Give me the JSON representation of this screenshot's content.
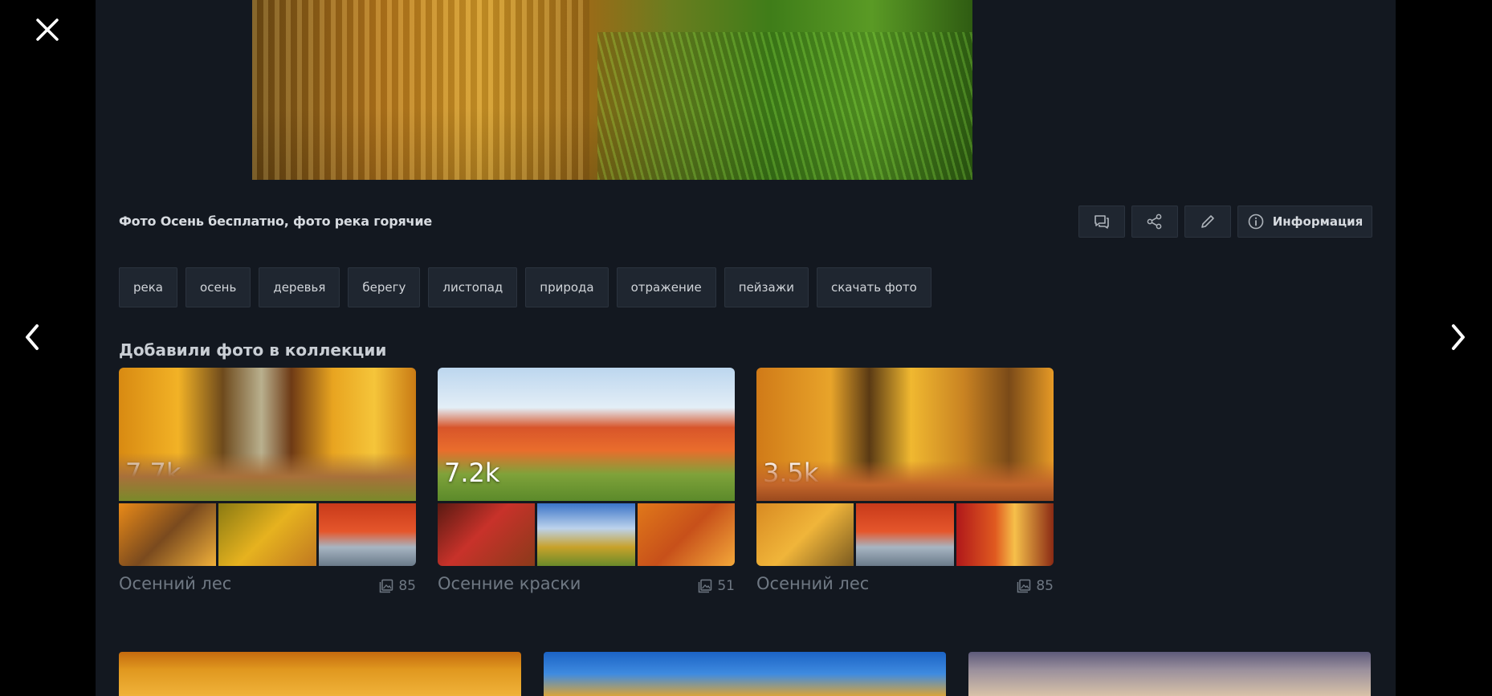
{
  "viewer": {
    "close_icon": "close-icon",
    "prev_icon": "chevron-left-icon",
    "next_icon": "chevron-right-icon"
  },
  "photo": {
    "title": "Фото Осень бесплатно, фото река горячие"
  },
  "actions": {
    "comment_icon": "comment-icon",
    "share_icon": "share-icon",
    "edit_icon": "pencil-icon",
    "info_icon": "info-icon",
    "info_label": "Информация"
  },
  "tags": [
    "река",
    "осень",
    "деревья",
    "берегу",
    "листопад",
    "природа",
    "отражение",
    "пейзажи",
    "скачать фото"
  ],
  "collections_section": {
    "title": "Добавили фото в коллекции",
    "items": [
      {
        "count": "7.7k",
        "name": "Осенний лес",
        "photos": "85"
      },
      {
        "count": "7.2k",
        "name": "Осенние краски",
        "photos": "51"
      },
      {
        "count": "3.5k",
        "name": "Осенний лес",
        "photos": "85"
      }
    ]
  },
  "colors": {
    "panel_bg": "#131820",
    "button_bg": "#1f2630",
    "muted_text": "#6f7883"
  }
}
